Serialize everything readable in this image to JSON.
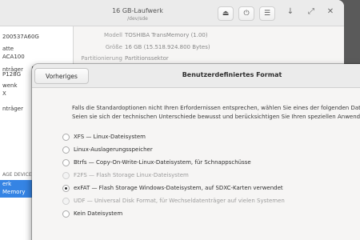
{
  "bg_window": {
    "title": "16 GB-Laufwerk",
    "subtitle": "/dev/sde",
    "info": [
      {
        "label": "Modell",
        "value": "TOSHIBA TransMemory (1.00)"
      },
      {
        "label": "Größe",
        "value": "16 GB (15.518.924.800 Bytes)"
      },
      {
        "label": "Partitionierung",
        "value": "Partitionssektor"
      }
    ],
    "sidebar": [
      "200537A60G",
      "atte",
      "ACA100",
      "nträger",
      "P128G",
      "wenk",
      "X",
      "nträger",
      "AGE DEVICE",
      "erk",
      "Memory"
    ],
    "icons": [
      "eject-icon",
      "power-icon",
      "menu-icon",
      "minimize-icon",
      "maximize-icon",
      "close-icon"
    ]
  },
  "dialog": {
    "back_label": "Vorheriges",
    "title": "Benutzerdefiniertes Format",
    "description_line1": "Falls die Standardoptionen nicht Ihren Erfordernissen entsprechen, wählen Sie eines der folgenden Dateis",
    "description_line2": "Seien sie sich der technischen Unterschiede bewusst und berücksichtigen Sie Ihren speziellen Anwendun",
    "options": [
      {
        "label": "XFS — Linux-Dateisystem",
        "selected": false,
        "disabled": false
      },
      {
        "label": "Linux-Auslagerungsspeicher",
        "selected": false,
        "disabled": false
      },
      {
        "label": "Btrfs — Copy-On-Write-Linux-Dateisystem, für Schnappschüsse",
        "selected": false,
        "disabled": false
      },
      {
        "label": "F2FS — Flash Storage Linux-Dateisystem",
        "selected": false,
        "disabled": true
      },
      {
        "label": "exFAT — Flash Storage Windows-Dateisystem, auf SDXC-Karten verwendet",
        "selected": true,
        "disabled": false
      },
      {
        "label": "UDF — Universal Disk Format, für Wechseldatenträger auf vielen Systemen",
        "selected": false,
        "disabled": true
      },
      {
        "label": "Kein Dateisystem",
        "selected": false,
        "disabled": false
      }
    ]
  },
  "colors": {
    "accent": "#3584e4",
    "header": "#ebebeb",
    "background": "#f6f5f4"
  }
}
